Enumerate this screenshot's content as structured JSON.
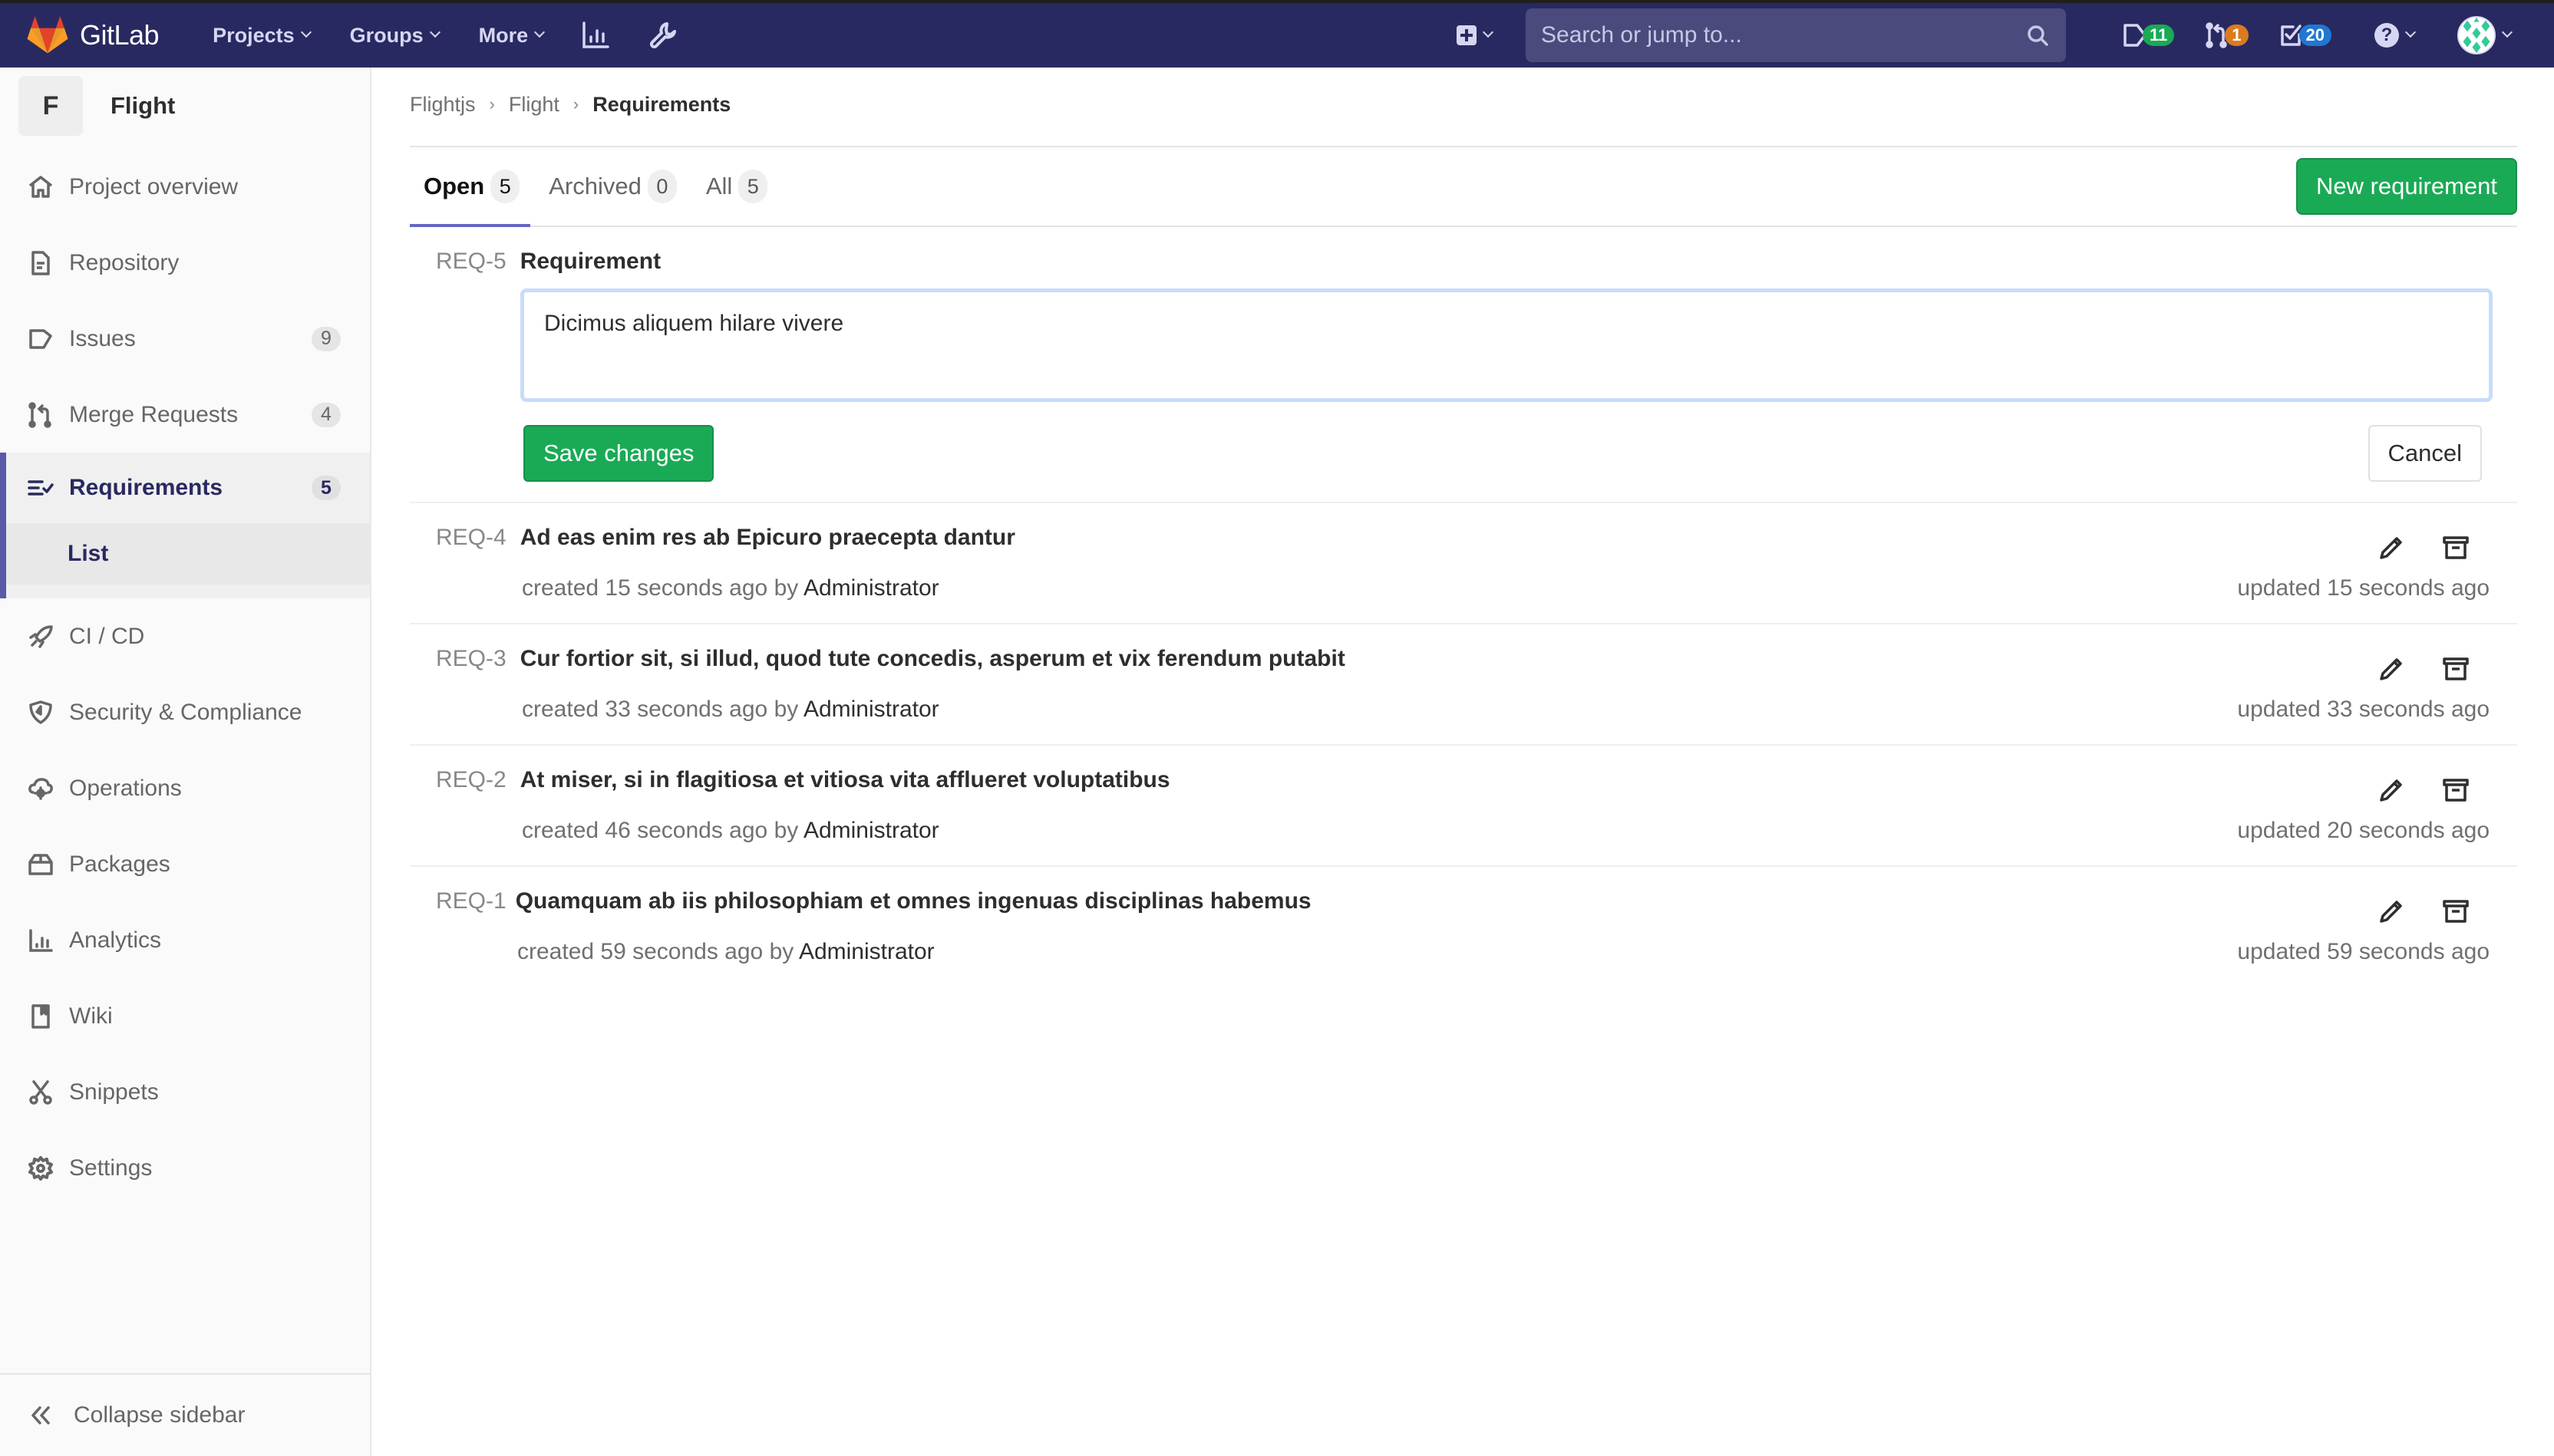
{
  "navbar": {
    "brand": "GitLab",
    "menus": [
      {
        "label": "Projects"
      },
      {
        "label": "Groups"
      },
      {
        "label": "More"
      }
    ],
    "search_placeholder": "Search or jump to...",
    "counters": {
      "issues": "11",
      "merge_requests": "1",
      "todos": "20"
    },
    "colors": {
      "bg": "#292961",
      "issues_badge": "#1aaa55",
      "mr_badge": "#db7b1f",
      "todos_badge": "#1f78d1"
    }
  },
  "sidebar": {
    "project_initial": "F",
    "project_name": "Flight",
    "items": [
      {
        "label": "Project overview",
        "icon": "home-icon"
      },
      {
        "label": "Repository",
        "icon": "document-icon"
      },
      {
        "label": "Issues",
        "icon": "issues-icon",
        "count": "9"
      },
      {
        "label": "Merge Requests",
        "icon": "merge-request-icon",
        "count": "4"
      },
      {
        "label": "Requirements",
        "icon": "requirements-icon",
        "count": "5",
        "active": true,
        "sub": "List"
      },
      {
        "label": "CI / CD",
        "icon": "rocket-icon"
      },
      {
        "label": "Security & Compliance",
        "icon": "shield-icon"
      },
      {
        "label": "Operations",
        "icon": "cloud-gear-icon"
      },
      {
        "label": "Packages",
        "icon": "package-icon"
      },
      {
        "label": "Analytics",
        "icon": "chart-icon"
      },
      {
        "label": "Wiki",
        "icon": "book-icon"
      },
      {
        "label": "Snippets",
        "icon": "scissors-icon"
      },
      {
        "label": "Settings",
        "icon": "gear-icon"
      }
    ],
    "collapse_label": "Collapse sidebar"
  },
  "breadcrumb": {
    "items": [
      "Flightjs",
      "Flight"
    ],
    "current": "Requirements"
  },
  "tabs": [
    {
      "label": "Open",
      "count": "5",
      "active": true
    },
    {
      "label": "Archived",
      "count": "0"
    },
    {
      "label": "All",
      "count": "5"
    }
  ],
  "new_button": "New requirement",
  "edit_form": {
    "ref": "REQ-5",
    "label": "Requirement",
    "value": "Dicimus aliquem hilare vivere",
    "save_label": "Save changes",
    "cancel_label": "Cancel"
  },
  "requirements": [
    {
      "ref": "REQ-4",
      "title": "Ad eas enim res ab Epicuro praecepta dantur",
      "created": "created 15 seconds ago by",
      "author": "Administrator",
      "updated": "updated 15 seconds ago"
    },
    {
      "ref": "REQ-3",
      "title": "Cur fortior sit, si illud, quod tute concedis, asperum et vix ferendum putabit",
      "created": "created 33 seconds ago by",
      "author": "Administrator",
      "updated": "updated 33 seconds ago"
    },
    {
      "ref": "REQ-2",
      "title": "At miser, si in flagitiosa et vitiosa vita afflueret voluptatibus",
      "created": "created 46 seconds ago by",
      "author": "Administrator",
      "updated": "updated 20 seconds ago"
    },
    {
      "ref": "REQ-1",
      "title": "Quamquam ab iis philosophiam et omnes ingenuas disciplinas habemus",
      "created": "created 59 seconds ago by",
      "author": "Administrator",
      "updated": "updated 59 seconds ago"
    }
  ]
}
